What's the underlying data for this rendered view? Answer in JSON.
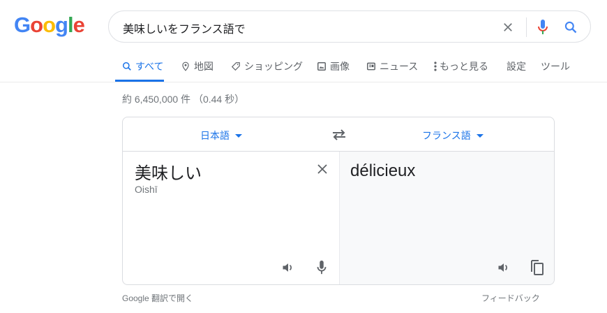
{
  "logo": "Google",
  "search": {
    "query": "美味しいをフランス語で"
  },
  "tabs": [
    {
      "label": "すべて"
    },
    {
      "label": "地図"
    },
    {
      "label": "ショッピング"
    },
    {
      "label": "画像"
    },
    {
      "label": "ニュース"
    },
    {
      "label": "もっと見る"
    },
    {
      "label": "設定"
    },
    {
      "label": "ツール"
    }
  ],
  "stats": "約 6,450,000 件 （0.44 秒）",
  "translate": {
    "source_lang": "日本語",
    "target_lang": "フランス語",
    "source_text": "美味しい",
    "romanization": "Oishī",
    "target_text": "délicieux"
  },
  "footer": {
    "open": "Google 翻訳で開く",
    "feedback": "フィードバック"
  },
  "colors": {
    "accent": "#1a73e8"
  }
}
